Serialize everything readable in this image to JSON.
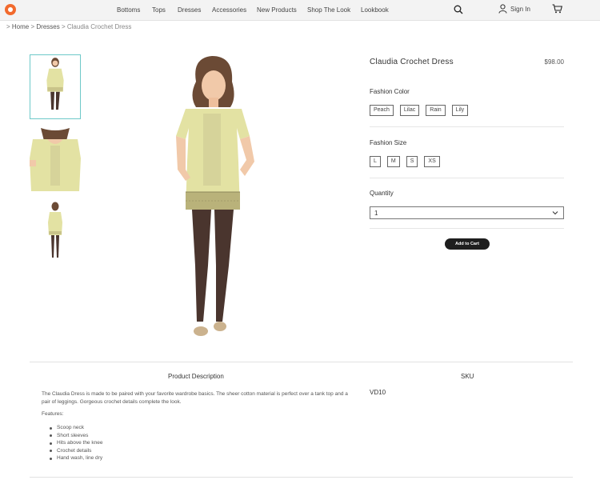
{
  "nav": {
    "items": [
      "Bottoms",
      "Tops",
      "Dresses",
      "Accessories",
      "New Products",
      "Shop The Look",
      "Lookbook"
    ],
    "sign_in": "Sign In"
  },
  "breadcrumb": {
    "prefix": ">",
    "home": "Home",
    "sep": ">",
    "category": "Dresses",
    "current": "Claudia Crochet Dress"
  },
  "product": {
    "title": "Claudia Crochet Dress",
    "price": "$98.00",
    "color_label": "Fashion Color",
    "colors": [
      "Peach",
      "Lilac",
      "Rain",
      "Lily"
    ],
    "size_label": "Fashion Size",
    "sizes": [
      "L",
      "M",
      "S",
      "XS"
    ],
    "quantity_label": "Quantity",
    "quantity_value": "1",
    "add_to_cart": "Add to Cart"
  },
  "details": {
    "description_heading": "Product Description",
    "description": "The Claudia Dress is made to be paired with your favorite wardrobe basics. The sheer cotton material is perfect over a tank top and a pair of leggings. Gorgeous crochet details complete the look.",
    "features_heading": "Features:",
    "features": [
      "Scoop neck",
      "Short sleeves",
      "Hits above the knee",
      "Crochet details",
      "Hand wash, line dry"
    ],
    "sku_heading": "SKU",
    "sku_value": "VD10"
  },
  "colors": {
    "accent_border": "#6ec9c9",
    "button_bg": "#1e1e1e",
    "logo": "#f26a2d",
    "dress": "#e3e2a3",
    "leggings": "#4a352e"
  },
  "icons": [
    "logo-icon",
    "search-icon",
    "user-icon",
    "cart-icon",
    "chevron-down-icon"
  ]
}
